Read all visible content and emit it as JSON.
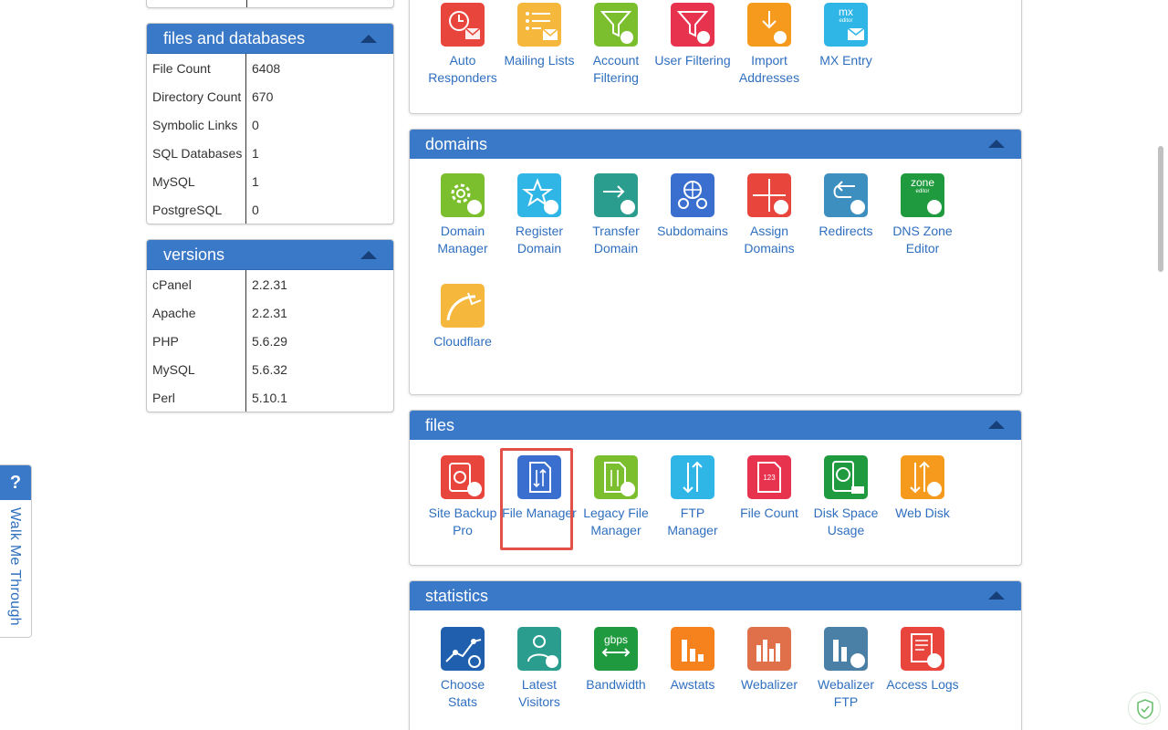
{
  "left": {
    "files_databases": {
      "title": "files and databases",
      "rows": [
        {
          "k": "File Count",
          "v": "6408"
        },
        {
          "k": "Directory Count",
          "v": "670"
        },
        {
          "k": "Symbolic Links",
          "v": "0"
        },
        {
          "k": "SQL Databases",
          "v": "1"
        },
        {
          "k": "MySQL",
          "v": "1"
        },
        {
          "k": "PostgreSQL",
          "v": "0"
        }
      ]
    },
    "versions": {
      "title": "versions",
      "rows": [
        {
          "k": "cPanel",
          "v": "2.2.31"
        },
        {
          "k": "Apache",
          "v": "2.2.31"
        },
        {
          "k": "PHP",
          "v": "5.6.29"
        },
        {
          "k": "MySQL",
          "v": "5.6.32"
        },
        {
          "k": "Perl",
          "v": "5.10.1"
        }
      ]
    }
  },
  "email": {
    "items": [
      {
        "label": "Auto Responders",
        "icon": "auto-responders-icon",
        "color": "#e8453c"
      },
      {
        "label": "Mailing Lists",
        "icon": "mailing-lists-icon",
        "color": "#f5b83c"
      },
      {
        "label": "Account Filtering",
        "icon": "account-filtering-icon",
        "color": "#7cbf2e"
      },
      {
        "label": "User Filtering",
        "icon": "user-filtering-icon",
        "color": "#e8334f"
      },
      {
        "label": "Import Addresses",
        "icon": "import-addresses-icon",
        "color": "#f59a1c"
      },
      {
        "label": "MX Entry",
        "icon": "mx-entry-icon",
        "color": "#2fb6e6",
        "text": "mx",
        "sub": "editor"
      }
    ]
  },
  "domains": {
    "title": "domains",
    "items": [
      {
        "label": "Domain Manager",
        "icon": "domain-manager-icon",
        "color": "#7cbf2e"
      },
      {
        "label": "Register Domain",
        "icon": "register-domain-icon",
        "color": "#2fb6e6"
      },
      {
        "label": "Transfer Domain",
        "icon": "transfer-domain-icon",
        "color": "#2a9d8f"
      },
      {
        "label": "Subdomains",
        "icon": "subdomains-icon",
        "color": "#3a6fcf"
      },
      {
        "label": "Assign Domains",
        "icon": "assign-domains-icon",
        "color": "#e8453c"
      },
      {
        "label": "Redirects",
        "icon": "redirects-icon",
        "color": "#3d8fbf"
      },
      {
        "label": "DNS Zone Editor",
        "icon": "dns-zone-editor-icon",
        "color": "#1f9a3e",
        "text": "zone",
        "sub": "editor"
      },
      {
        "label": "Cloudflare",
        "icon": "cloudflare-icon",
        "color": "#f5b83c"
      }
    ]
  },
  "files": {
    "title": "files",
    "items": [
      {
        "label": "Site Backup Pro",
        "icon": "site-backup-pro-icon",
        "color": "#e8453c"
      },
      {
        "label": "File Manager",
        "icon": "file-manager-icon",
        "color": "#3a6fcf"
      },
      {
        "label": "Legacy File Manager",
        "icon": "legacy-file-manager-icon",
        "color": "#7cbf2e"
      },
      {
        "label": "FTP Manager",
        "icon": "ftp-manager-icon",
        "color": "#2fb6e6"
      },
      {
        "label": "File Count",
        "icon": "file-count-icon",
        "color": "#e8334f",
        "text": "123"
      },
      {
        "label": "Disk Space Usage",
        "icon": "disk-space-usage-icon",
        "color": "#1f9a3e"
      },
      {
        "label": "Web Disk",
        "icon": "web-disk-icon",
        "color": "#f59a1c"
      }
    ]
  },
  "statistics": {
    "title": "statistics",
    "items": [
      {
        "label": "Choose Stats",
        "icon": "choose-stats-icon",
        "color": "#1f5fae"
      },
      {
        "label": "Latest Visitors",
        "icon": "latest-visitors-icon",
        "color": "#2a9d8f"
      },
      {
        "label": "Bandwidth",
        "icon": "bandwidth-icon",
        "color": "#1f9a3e",
        "text": "gbps"
      },
      {
        "label": "Awstats",
        "icon": "awstats-icon",
        "color": "#f5821c"
      },
      {
        "label": "Webalizer",
        "icon": "webalizer-icon",
        "color": "#e0704a"
      },
      {
        "label": "Webalizer FTP",
        "icon": "webalizer-ftp-icon",
        "color": "#4a7fa6"
      },
      {
        "label": "Access Logs",
        "icon": "access-logs-icon",
        "color": "#e8453c"
      }
    ]
  },
  "walkme": {
    "q": "?",
    "label": "Walk Me Through"
  }
}
